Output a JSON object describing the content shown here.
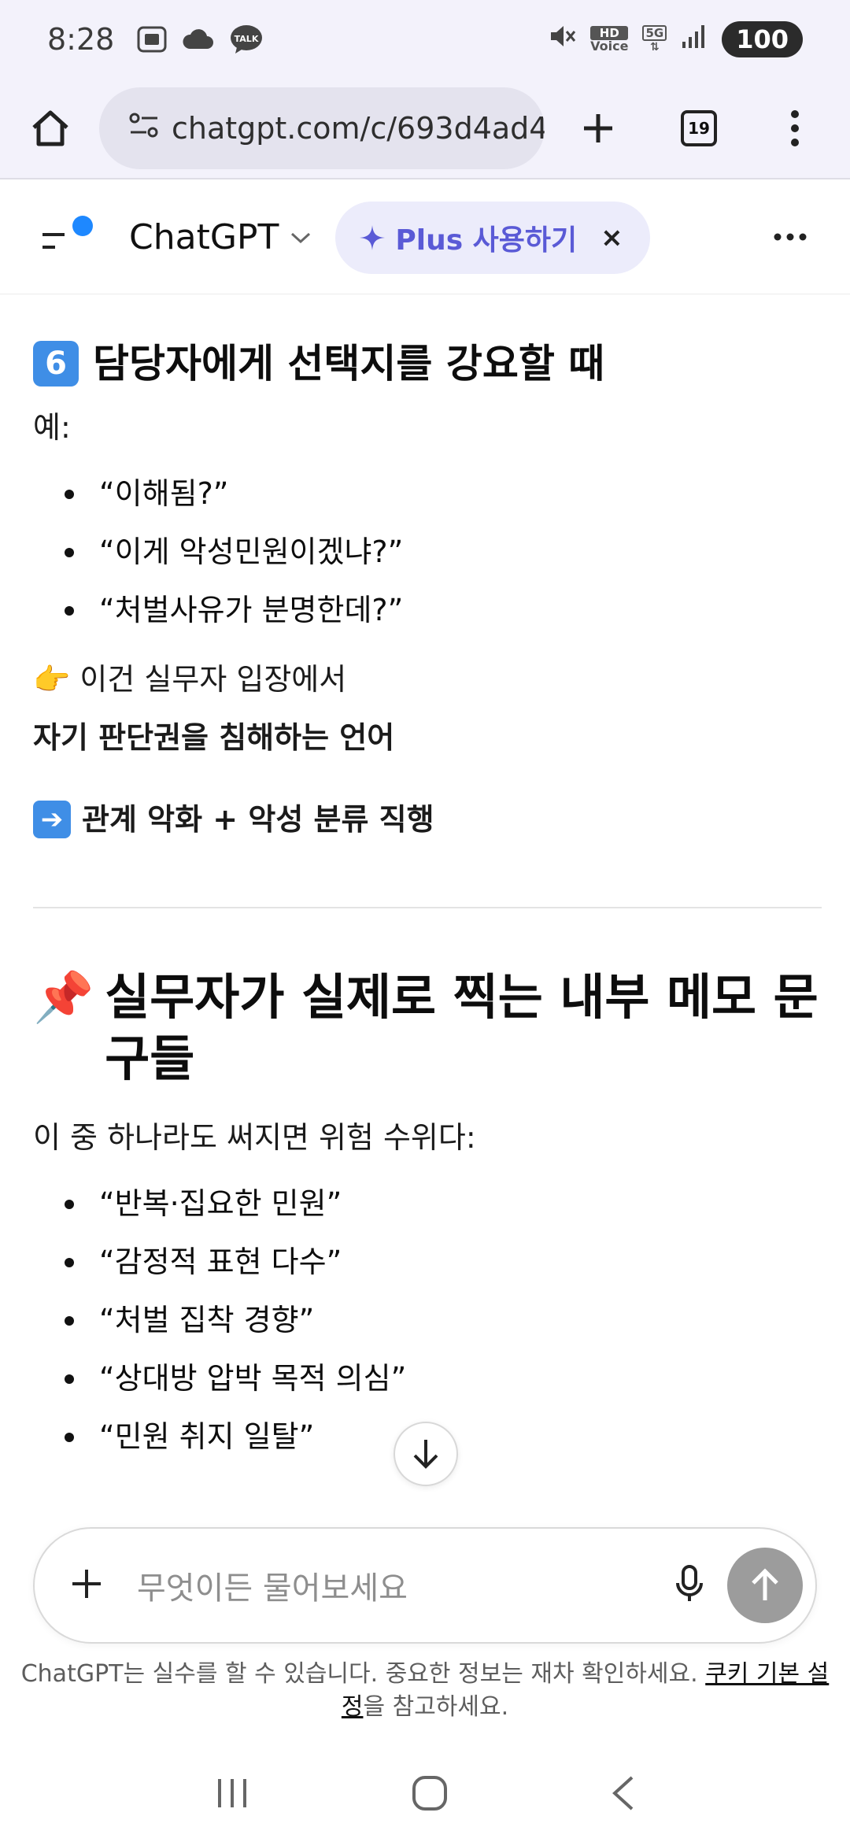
{
  "status_bar": {
    "time": "8:28",
    "talk_badge": "TALK",
    "hd_voice_top": "HD",
    "hd_voice_bottom": "Voice",
    "network": "5G",
    "battery": "100"
  },
  "browser": {
    "url": "chatgpt.com/c/693d4ad4-",
    "tab_count": "19"
  },
  "app_header": {
    "title": "ChatGPT",
    "plus_label": "Plus 사용하기",
    "close_glyph": "×"
  },
  "content": {
    "section6": {
      "number": "6",
      "heading": "담당자에게 선택지를 강요할 때",
      "example_label": "예:",
      "bullets": [
        "“이해됨?”",
        "“이게 악성민원이겠냐?”",
        "“처벌사유가 분명한데?”"
      ],
      "pointer_emoji": "👉",
      "note_line1": "이건 실무자 입장에서",
      "note_line2": "자기 판단권을 침해하는 언어",
      "result_text": "관계 악화 + 악성 분류 직행"
    },
    "memo_section": {
      "pin_emoji": "📌",
      "heading": "실무자가 실제로 찍는 내부 메모 문구들",
      "intro": "이 중 하나라도 써지면 위험 수위다:",
      "bullets": [
        "“반복·집요한 민원”",
        "“감정적 표현 다수”",
        "“처벌 집착 경향”",
        "“상대방 압박 목적 의심”",
        "“민원 취지 일탈”"
      ]
    }
  },
  "composer": {
    "placeholder": "무엇이든 물어보세요"
  },
  "disclaimer": {
    "text": "ChatGPT는 실수를 할 수 있습니다. 중요한 정보는 재차 확인하세요. ",
    "link": "쿠키 기본 설정",
    "suffix": "을 참고하세요."
  },
  "icons": {
    "home": "home-icon",
    "site_settings": "site-settings-icon",
    "new_tab": "plus-icon",
    "menu": "more-vertical-icon",
    "sidebar": "sidebar-menu-icon",
    "sparkle": "sparkle-icon",
    "more": "more-horizontal-icon",
    "mic": "mic-icon",
    "send": "arrow-up-icon",
    "scroll_down": "arrow-down-icon"
  },
  "colors": {
    "accent": "#5a5ad6",
    "status_dot": "#1e88ff",
    "send_disabled": "#9c9c9c"
  }
}
